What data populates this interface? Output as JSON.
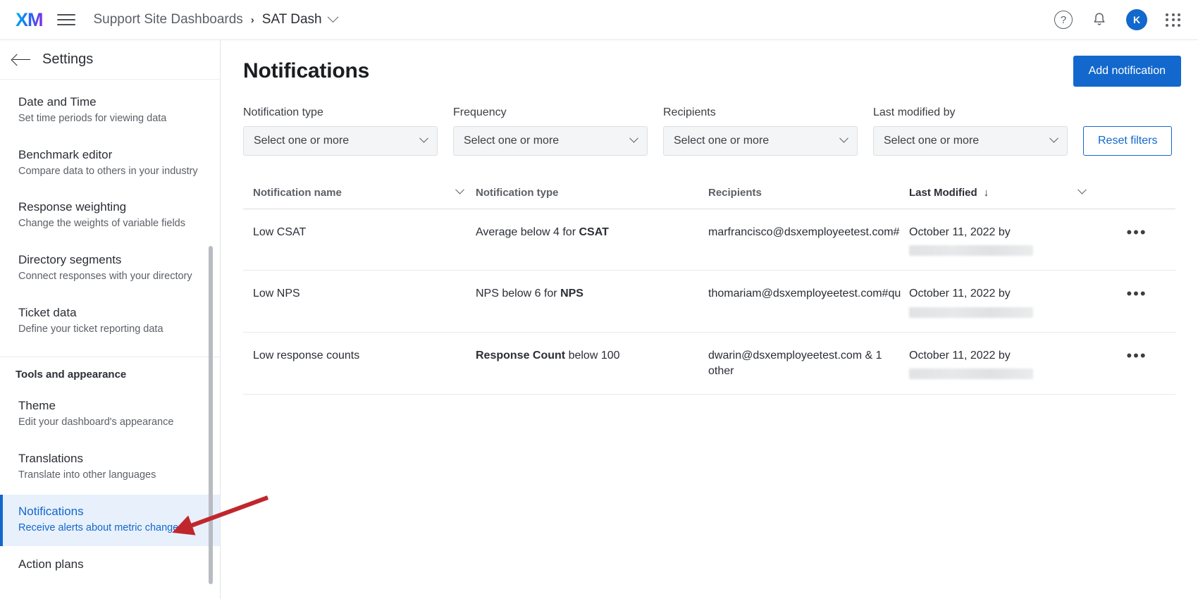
{
  "topbar": {
    "logo_text": "XM",
    "menu_icon": "hamburger-icon",
    "breadcrumb": {
      "root": "Support Site Dashboards",
      "separator": "›",
      "current": "SAT Dash"
    },
    "help_glyph": "?",
    "avatar_initial": "K"
  },
  "sidebar": {
    "title": "Settings",
    "items": [
      {
        "title": "Date and Time",
        "sub": "Set time periods for viewing data",
        "selected": false
      },
      {
        "title": "Benchmark editor",
        "sub": "Compare data to others in your industry",
        "selected": false
      },
      {
        "title": "Response weighting",
        "sub": "Change the weights of variable fields",
        "selected": false
      },
      {
        "title": "Directory segments",
        "sub": "Connect responses with your directory",
        "selected": false
      },
      {
        "title": "Ticket data",
        "sub": "Define your ticket reporting data",
        "selected": false
      }
    ],
    "section_label": "Tools and appearance",
    "tools_items": [
      {
        "title": "Theme",
        "sub": "Edit your dashboard's appearance",
        "selected": false
      },
      {
        "title": "Translations",
        "sub": "Translate into other languages",
        "selected": false
      },
      {
        "title": "Notifications",
        "sub": "Receive alerts about metric changes",
        "selected": true
      },
      {
        "title": "Action plans",
        "sub": "",
        "selected": false
      }
    ]
  },
  "main": {
    "page_title": "Notifications",
    "add_button": "Add notification",
    "reset_button": "Reset filters",
    "filters": [
      {
        "label": "Notification type",
        "value": "Select one or more"
      },
      {
        "label": "Frequency",
        "value": "Select one or more"
      },
      {
        "label": "Recipients",
        "value": "Select one or more"
      },
      {
        "label": "Last modified by",
        "value": "Select one or more"
      }
    ],
    "table": {
      "columns": [
        {
          "label": "Notification name",
          "sorted": false
        },
        {
          "label": "Notification type",
          "sorted": false
        },
        {
          "label": "Recipients",
          "sorted": false
        },
        {
          "label": "Last Modified",
          "sorted": true,
          "sort_direction": "↓"
        }
      ],
      "rows": [
        {
          "name": "Low CSAT",
          "type_prefix": "Average below 4 for ",
          "type_bold": "CSAT",
          "type_suffix": "",
          "recipients": "marfrancisco@dsxemployeetest.com#",
          "modified_date": "October 11, 2022 by",
          "modified_by": "",
          "menu": "•••"
        },
        {
          "name": "Low NPS",
          "type_prefix": "NPS below 6 for ",
          "type_bold": "NPS",
          "type_suffix": "",
          "recipients": "thomariam@dsxemployeetest.com#qu",
          "modified_date": "October 11, 2022 by",
          "modified_by": "",
          "menu": "•••"
        },
        {
          "name": "Low response counts",
          "type_prefix": "",
          "type_bold": "Response Count",
          "type_suffix": " below 100",
          "recipients": "dwarin@dsxemployeetest.com & 1 other",
          "modified_date": "October 11, 2022 by",
          "modified_by": "",
          "menu": "•••"
        }
      ]
    }
  },
  "annotation": {
    "arrow_color": "#c0272d"
  },
  "colors": {
    "accent": "#1268cc",
    "selected_bg": "#e8f0fb",
    "text": "#2b2e34",
    "muted": "#5c6066",
    "border": "#e3e6e8"
  }
}
